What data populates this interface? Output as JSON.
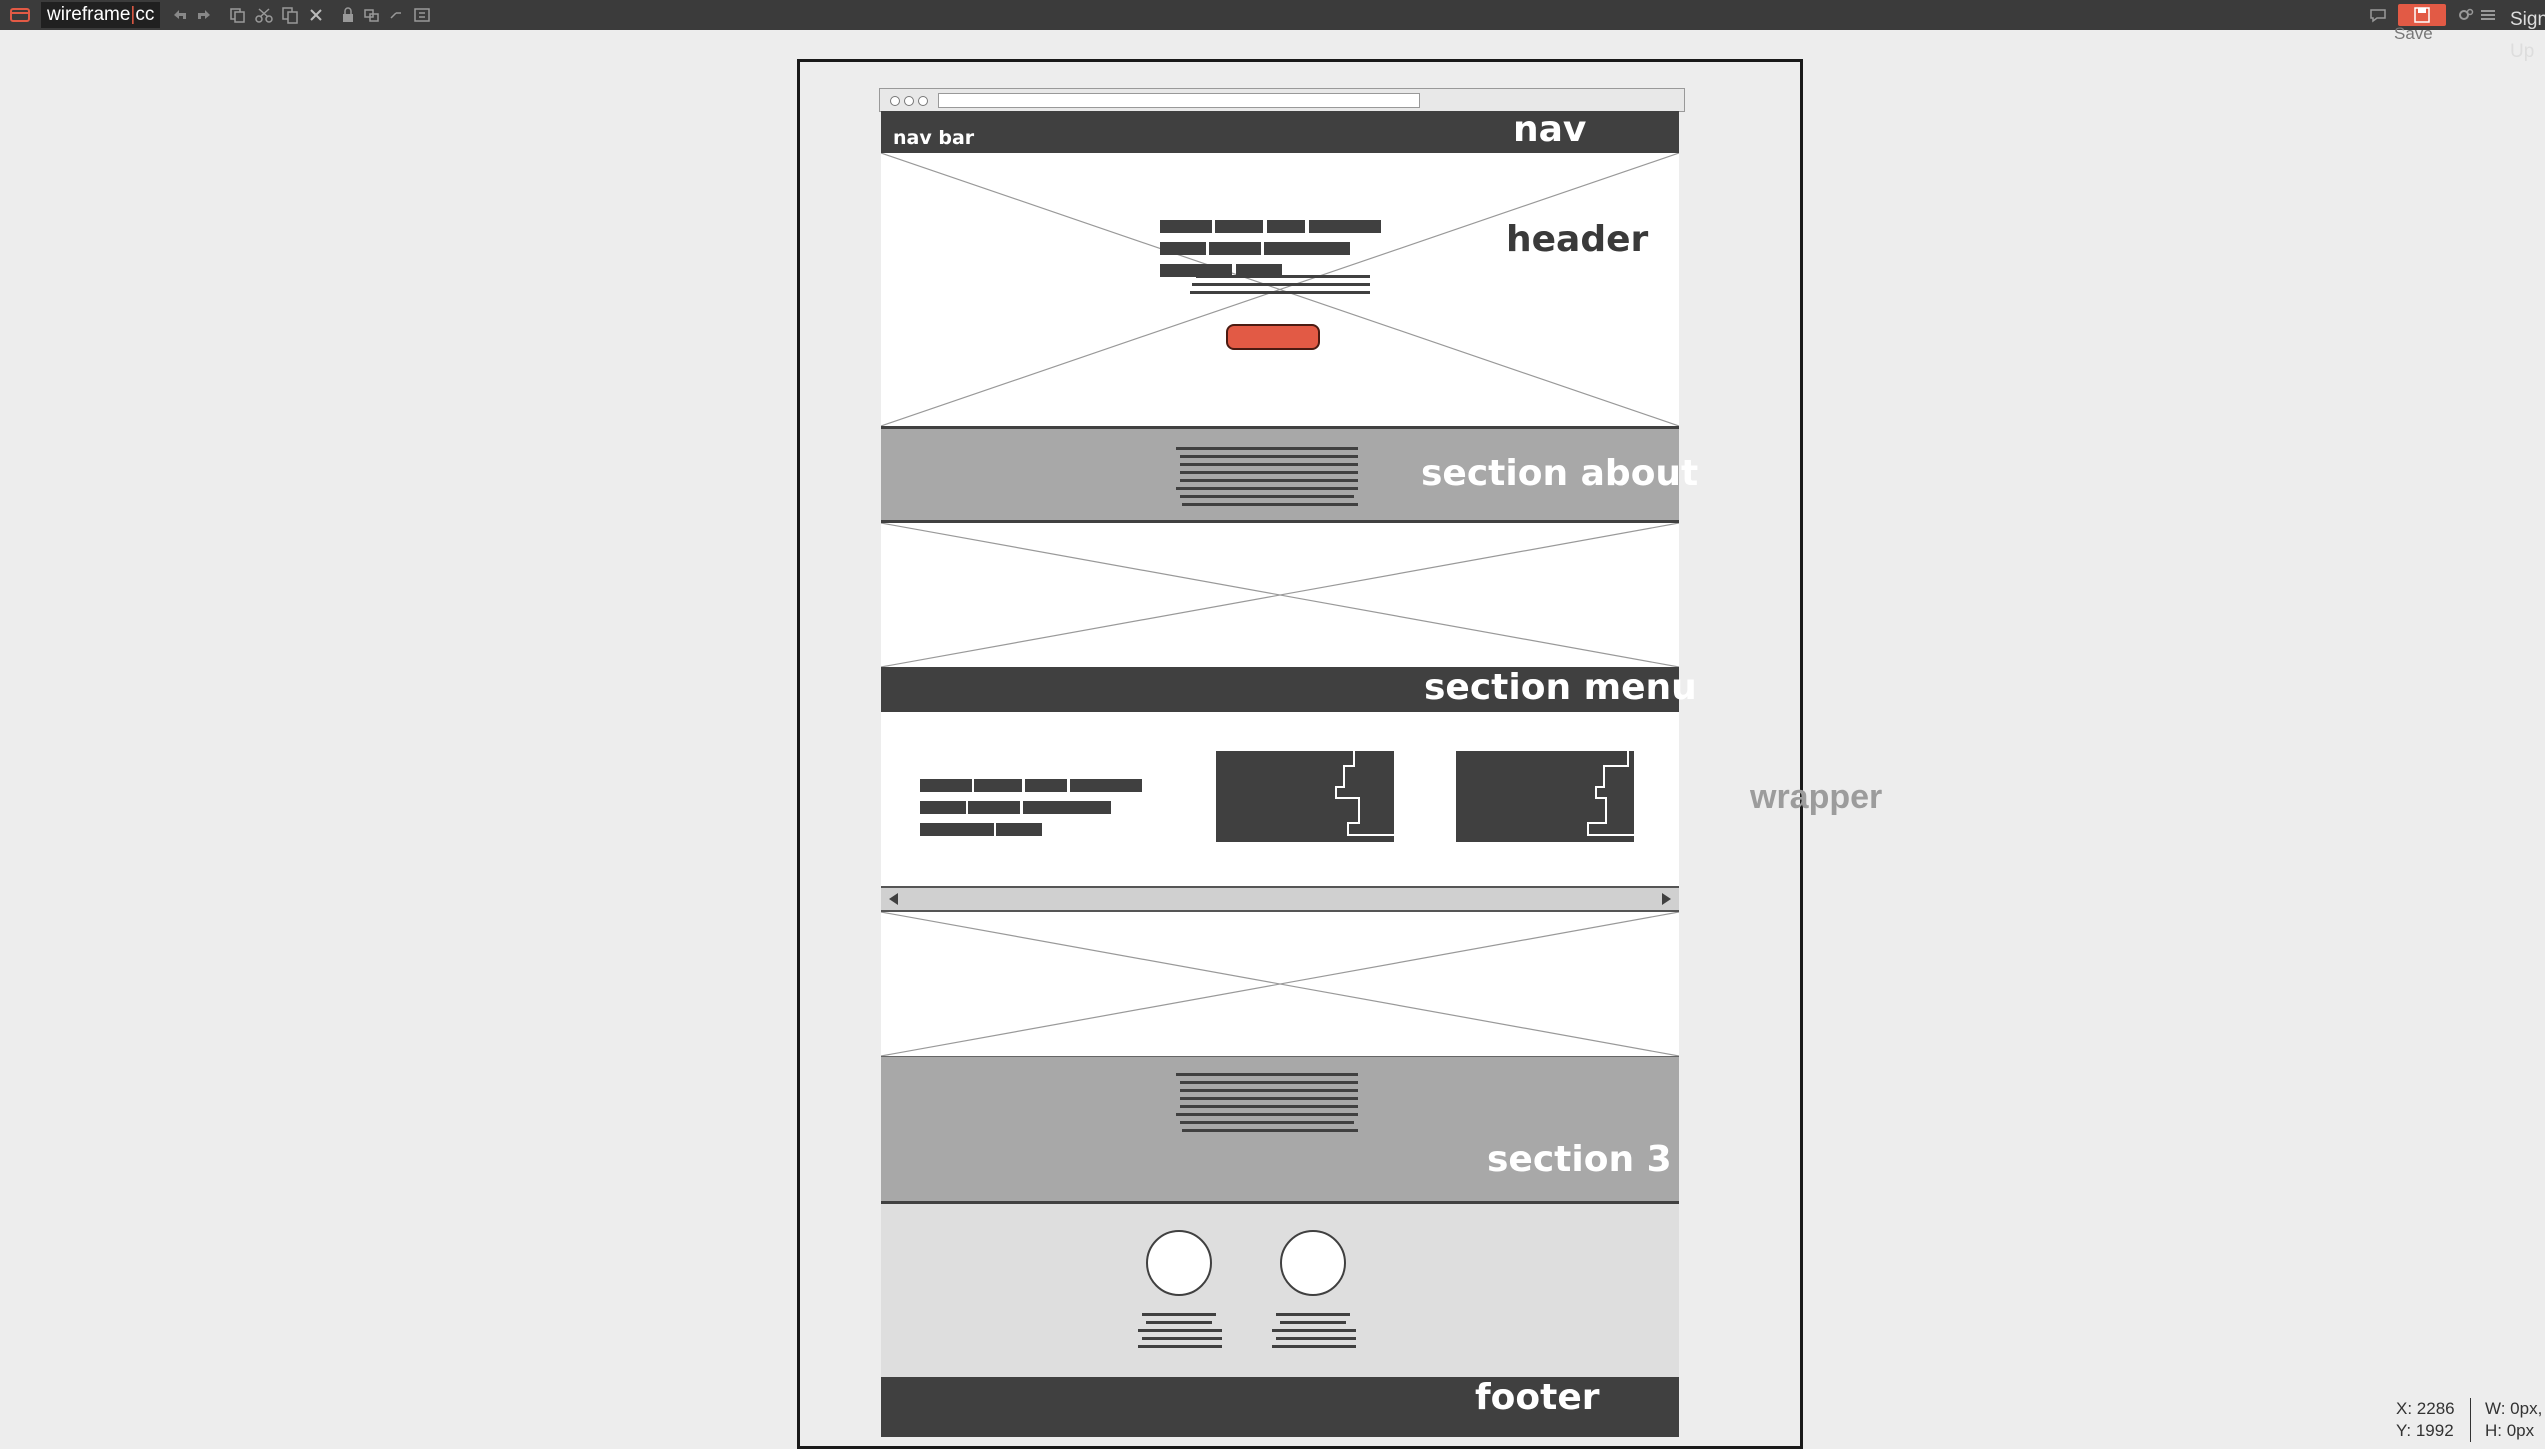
{
  "app": {
    "name_left": "wireframe",
    "name_right": "cc",
    "save_label": "Save",
    "signup_label": "Sign Up",
    "accent_color": "#e25a45"
  },
  "toolbar": {
    "icons": [
      "undo-icon",
      "redo-icon",
      "duplicate-icon",
      "cut-icon",
      "copy-icon",
      "delete-icon",
      "lock-icon",
      "group-icon",
      "ungroup-icon",
      "align-icon"
    ]
  },
  "status": {
    "x": "X: 2286",
    "y": "Y: 1992",
    "w": "W: 0px,",
    "h": "H: 0px"
  },
  "canvas": {
    "wrapper_label": "wrapper",
    "nav_label": "nav",
    "nav_bar_text": "nav bar",
    "header_label": "header",
    "about_label": "section about",
    "menu_label": "section menu",
    "section3_label": "section 3",
    "footer_label": "footer"
  }
}
